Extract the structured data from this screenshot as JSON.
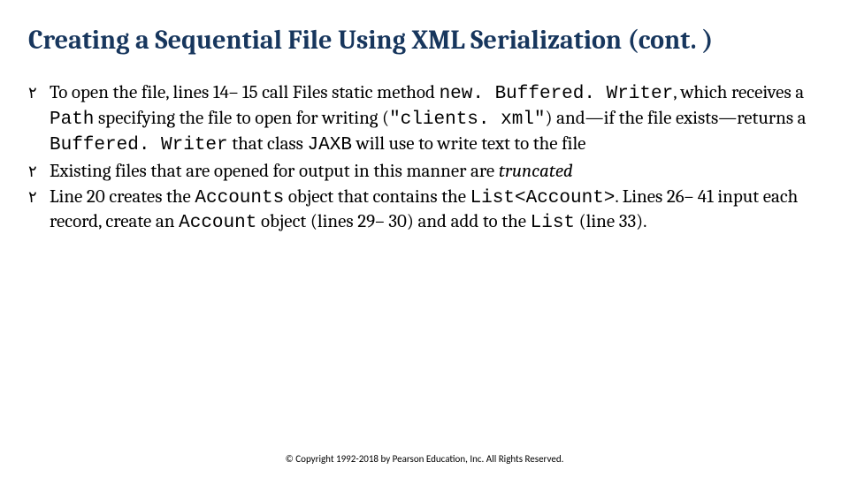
{
  "title": "Creating a Sequential File Using XML Serialization (cont. )",
  "bullets": [
    {
      "marker": "٢",
      "b1_t1": "To open the file, lines 14– 15 call Files static method ",
      "b1_t2": "new. Buffered. Writer",
      "b1_t3": ", which receives a ",
      "b1_t4": "Path",
      "b1_t5": " specifying the file to open for writing (",
      "b1_t6": "\"clients. xml\"",
      "b1_t7": ") and—if the file exists—returns a ",
      "b1_t8": "Buffered. Writer",
      "b1_t9": " that class ",
      "b1_t10": "JAXB",
      "b1_t11": " will use to write text to the file"
    },
    {
      "marker": "٢",
      "b2_t1": "Existing files that are opened for output in this manner are ",
      "b2_t2": "truncated"
    },
    {
      "marker": "٢",
      "b3_t1": "Line 20 creates the ",
      "b3_t2": "Accounts",
      "b3_t3": " object that contains the ",
      "b3_t4": "List<Account>",
      "b3_t5": ". Lines 26– 41 input each record, create an ",
      "b3_t6": "Account",
      "b3_t7": " object (lines 29– 30) and add to the ",
      "b3_t8": "List",
      "b3_t9": " (line 33)."
    }
  ],
  "footer": "© Copyright 1992-2018 by Pearson Education, Inc. All Rights Reserved."
}
